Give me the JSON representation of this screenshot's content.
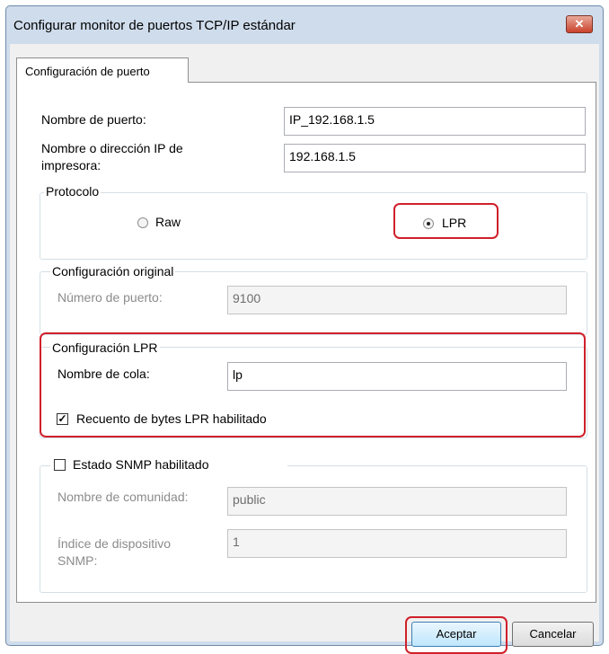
{
  "window": {
    "title": "Configurar monitor de puertos TCP/IP estándar",
    "close_glyph": "✕"
  },
  "tabs": [
    {
      "label": "Configuración de puerto",
      "selected": true
    }
  ],
  "port": {
    "name_label": "Nombre de puerto:",
    "name_value": "IP_192.168.1.5",
    "printer_label_line1": "Nombre o dirección IP de",
    "printer_label_line2": "impresora:",
    "printer_value": "192.168.1.5"
  },
  "protocol": {
    "legend": "Protocolo",
    "raw_label": "Raw",
    "lpr_label": "LPR",
    "selected": "LPR"
  },
  "raw_settings": {
    "legend": "Configuración original",
    "port_number_label": "Número de puerto:",
    "port_number_value": "9100"
  },
  "lpr_settings": {
    "legend": "Configuración LPR",
    "queue_label": "Nombre de cola:",
    "queue_value": "lp",
    "byte_count_label": "Recuento de bytes LPR habilitado",
    "byte_count_checked": true,
    "check_glyph": "✓"
  },
  "snmp": {
    "legend": "Estado SNMP habilitado",
    "enabled": false,
    "community_label": "Nombre de comunidad:",
    "community_value": "public",
    "device_index_label_line1": "Índice de dispositivo",
    "device_index_label_line2": "SNMP:",
    "device_index_value": "1"
  },
  "buttons": {
    "ok_label": "Aceptar",
    "cancel_label": "Cancelar"
  },
  "colors": {
    "highlight": "#d0202a",
    "titlebar": "#cfdcec",
    "close_button": "#c9422b"
  }
}
